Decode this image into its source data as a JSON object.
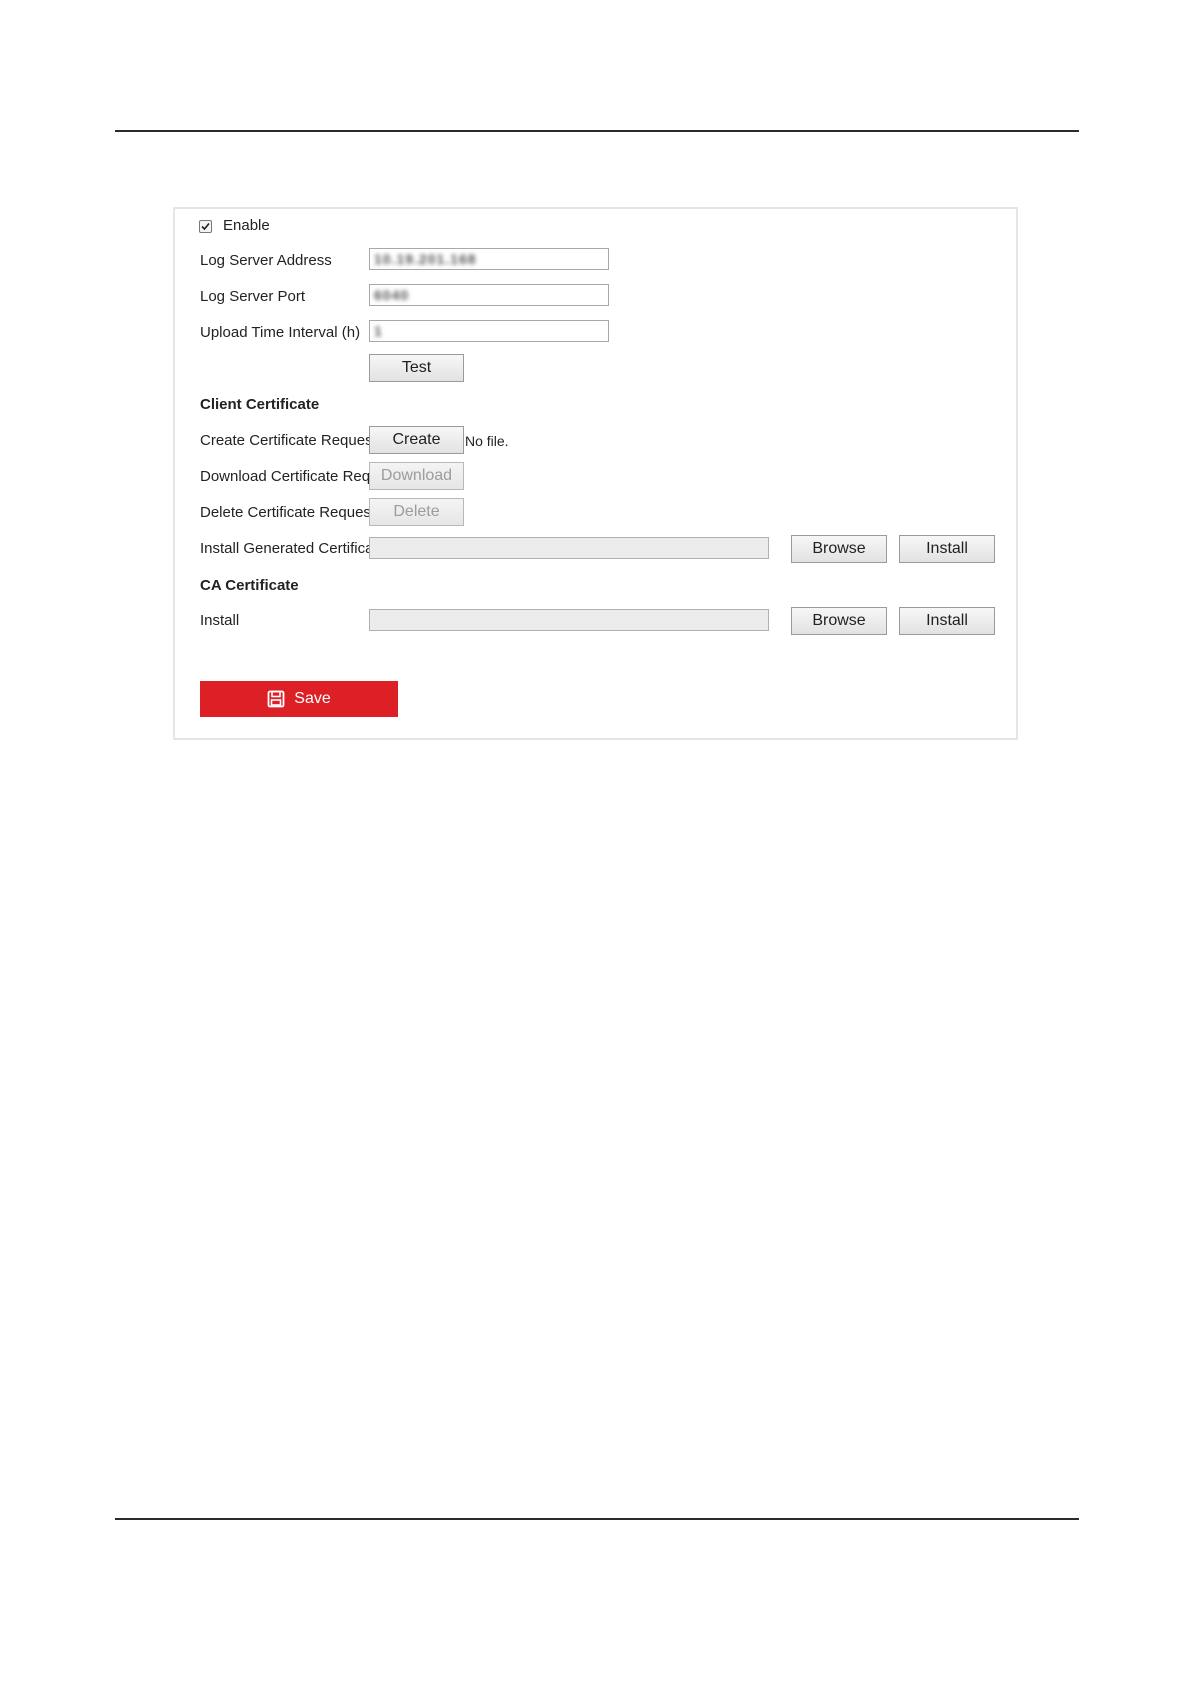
{
  "enable": {
    "label": "Enable",
    "checked": true
  },
  "fields": {
    "log_server_address": {
      "label": "Log Server Address",
      "value": "10.19.201.168"
    },
    "log_server_port": {
      "label": "Log Server Port",
      "value": "6040"
    },
    "upload_time_interval": {
      "label": "Upload Time Interval (h)",
      "value": "1"
    }
  },
  "test_button": "Test",
  "client_certificate": {
    "heading": "Client Certificate",
    "create_label": "Create Certificate Request",
    "create_button": "Create",
    "create_status": "No file.",
    "download_label": "Download Certificate Req...",
    "download_button": "Download",
    "delete_label": "Delete Certificate Request",
    "delete_button": "Delete",
    "install_label": "Install Generated Certificate",
    "browse_button": "Browse",
    "install_button": "Install"
  },
  "ca_certificate": {
    "heading": "CA Certificate",
    "install_label": "Install",
    "browse_button": "Browse",
    "install_button": "Install"
  },
  "save_button": "Save",
  "colors": {
    "save": "#dd1f26",
    "rule": "#2b2b2b",
    "panel_border": "#e6e6e6"
  },
  "icons": {
    "save": "save-icon",
    "check": "check-icon"
  }
}
